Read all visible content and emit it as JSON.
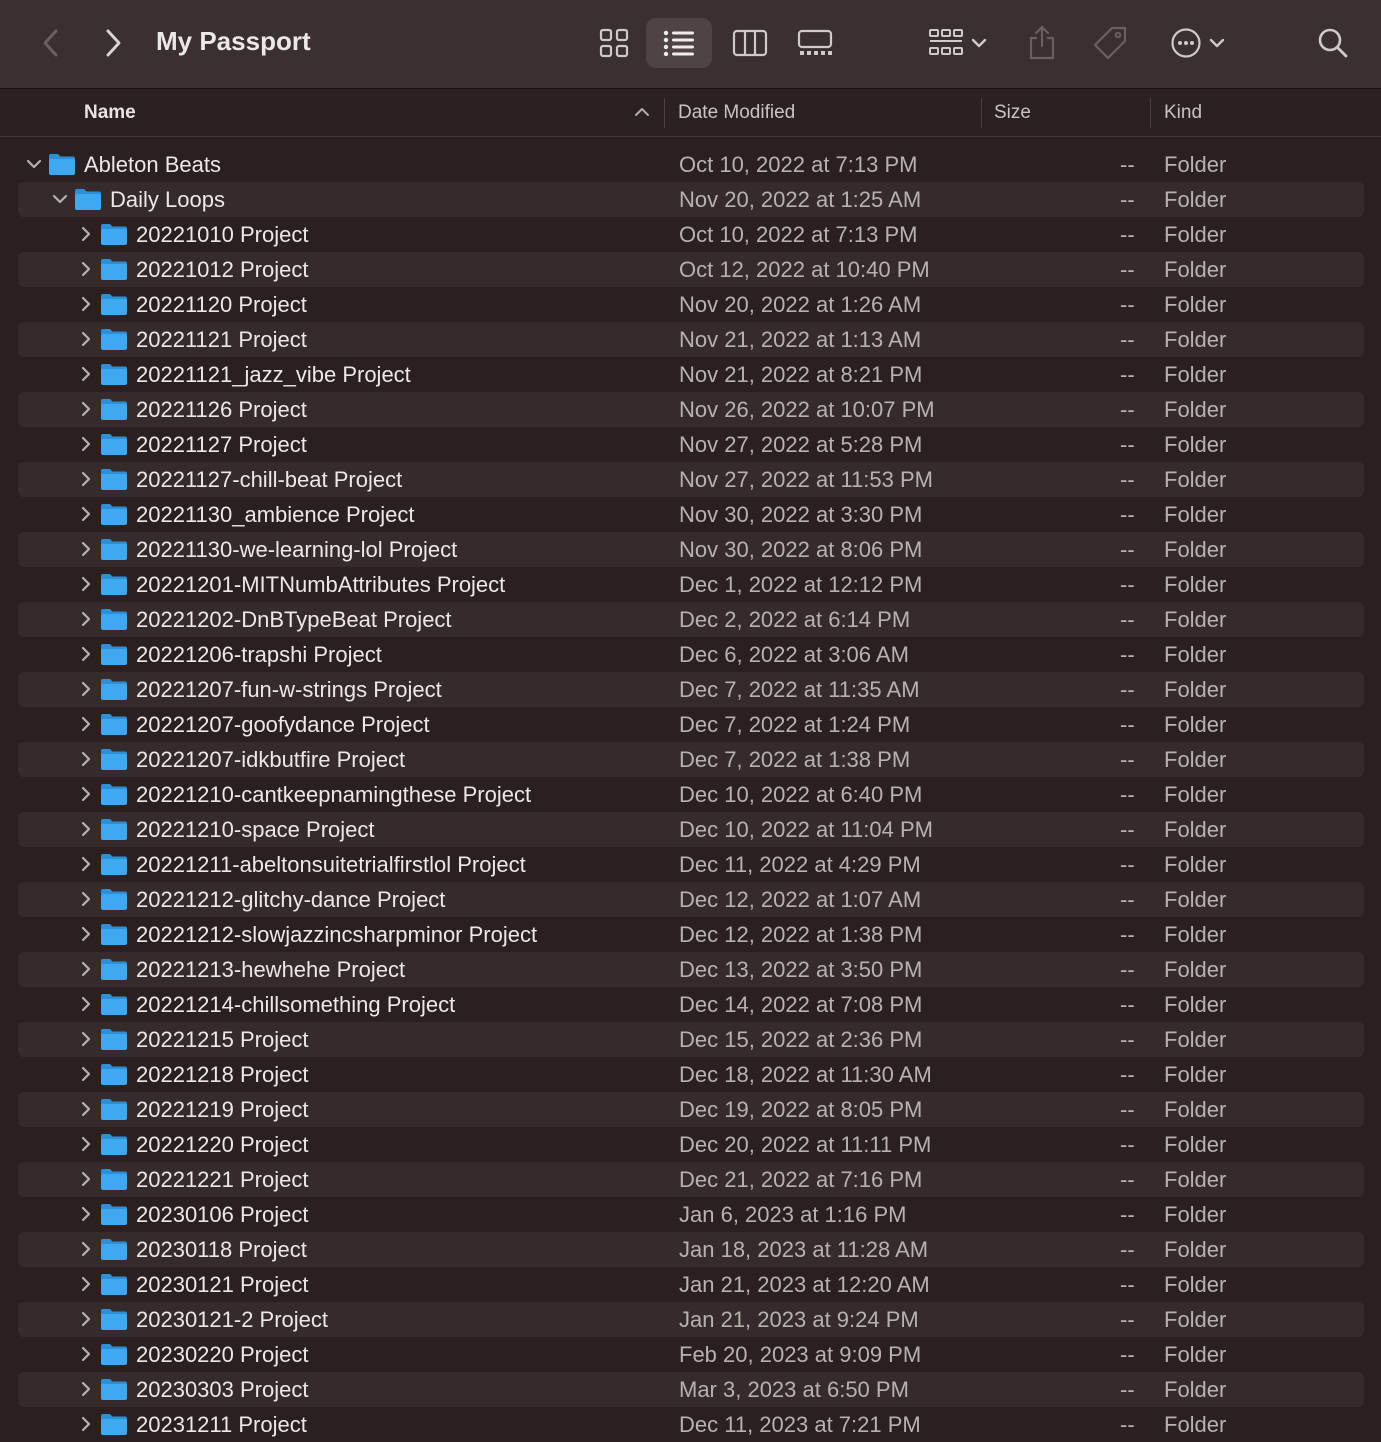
{
  "window": {
    "title": "My Passport"
  },
  "toolbar": {
    "back_icon": "chevron-left-icon",
    "forward_icon": "chevron-right-icon",
    "views": [
      "icon-view",
      "list-view",
      "column-view",
      "gallery-view"
    ],
    "selected_view": "list-view",
    "group_icon": "group-icon",
    "share_icon": "share-icon",
    "tag_icon": "tag-icon",
    "more_icon": "ellipsis-icon",
    "search_icon": "search-icon"
  },
  "columns": {
    "name": "Name",
    "date": "Date Modified",
    "size": "Size",
    "kind": "Kind",
    "sort_icon": "chevron-up-icon"
  },
  "colors": {
    "background": "#2b2020",
    "row_alt": "#362b2b",
    "folder": "#3fa9f0"
  },
  "rows": [
    {
      "name": "Ableton Beats",
      "date": "Oct 10, 2022 at 7:13 PM",
      "size": "--",
      "kind": "Folder",
      "level": 0,
      "expanded": true
    },
    {
      "name": "Daily Loops",
      "date": "Nov 20, 2022 at 1:25 AM",
      "size": "--",
      "kind": "Folder",
      "level": 1,
      "expanded": true
    },
    {
      "name": "20221010 Project",
      "date": "Oct 10, 2022 at 7:13 PM",
      "size": "--",
      "kind": "Folder",
      "level": 2,
      "expanded": false
    },
    {
      "name": "20221012 Project",
      "date": "Oct 12, 2022 at 10:40 PM",
      "size": "--",
      "kind": "Folder",
      "level": 2,
      "expanded": false
    },
    {
      "name": "20221120 Project",
      "date": "Nov 20, 2022 at 1:26 AM",
      "size": "--",
      "kind": "Folder",
      "level": 2,
      "expanded": false
    },
    {
      "name": "20221121 Project",
      "date": "Nov 21, 2022 at 1:13 AM",
      "size": "--",
      "kind": "Folder",
      "level": 2,
      "expanded": false
    },
    {
      "name": "20221121_jazz_vibe Project",
      "date": "Nov 21, 2022 at 8:21 PM",
      "size": "--",
      "kind": "Folder",
      "level": 2,
      "expanded": false
    },
    {
      "name": "20221126 Project",
      "date": "Nov 26, 2022 at 10:07 PM",
      "size": "--",
      "kind": "Folder",
      "level": 2,
      "expanded": false
    },
    {
      "name": "20221127 Project",
      "date": "Nov 27, 2022 at 5:28 PM",
      "size": "--",
      "kind": "Folder",
      "level": 2,
      "expanded": false
    },
    {
      "name": "20221127-chill-beat Project",
      "date": "Nov 27, 2022 at 11:53 PM",
      "size": "--",
      "kind": "Folder",
      "level": 2,
      "expanded": false
    },
    {
      "name": "20221130_ambience Project",
      "date": "Nov 30, 2022 at 3:30 PM",
      "size": "--",
      "kind": "Folder",
      "level": 2,
      "expanded": false
    },
    {
      "name": "20221130-we-learning-lol Project",
      "date": "Nov 30, 2022 at 8:06 PM",
      "size": "--",
      "kind": "Folder",
      "level": 2,
      "expanded": false
    },
    {
      "name": "20221201-MITNumbAttributes Project",
      "date": "Dec 1, 2022 at 12:12 PM",
      "size": "--",
      "kind": "Folder",
      "level": 2,
      "expanded": false
    },
    {
      "name": "20221202-DnBTypeBeat Project",
      "date": "Dec 2, 2022 at 6:14 PM",
      "size": "--",
      "kind": "Folder",
      "level": 2,
      "expanded": false
    },
    {
      "name": "20221206-trapshi Project",
      "date": "Dec 6, 2022 at 3:06 AM",
      "size": "--",
      "kind": "Folder",
      "level": 2,
      "expanded": false
    },
    {
      "name": "20221207-fun-w-strings Project",
      "date": "Dec 7, 2022 at 11:35 AM",
      "size": "--",
      "kind": "Folder",
      "level": 2,
      "expanded": false
    },
    {
      "name": "20221207-goofydance Project",
      "date": "Dec 7, 2022 at 1:24 PM",
      "size": "--",
      "kind": "Folder",
      "level": 2,
      "expanded": false
    },
    {
      "name": "20221207-idkbutfire Project",
      "date": "Dec 7, 2022 at 1:38 PM",
      "size": "--",
      "kind": "Folder",
      "level": 2,
      "expanded": false
    },
    {
      "name": "20221210-cantkeepnamingthese Project",
      "date": "Dec 10, 2022 at 6:40 PM",
      "size": "--",
      "kind": "Folder",
      "level": 2,
      "expanded": false
    },
    {
      "name": "20221210-space Project",
      "date": "Dec 10, 2022 at 11:04 PM",
      "size": "--",
      "kind": "Folder",
      "level": 2,
      "expanded": false
    },
    {
      "name": "20221211-abeltonsuitetrialfirstlol Project",
      "date": "Dec 11, 2022 at 4:29 PM",
      "size": "--",
      "kind": "Folder",
      "level": 2,
      "expanded": false
    },
    {
      "name": "20221212-glitchy-dance Project",
      "date": "Dec 12, 2022 at 1:07 AM",
      "size": "--",
      "kind": "Folder",
      "level": 2,
      "expanded": false
    },
    {
      "name": "20221212-slowjazzincsharpminor Project",
      "date": "Dec 12, 2022 at 1:38 PM",
      "size": "--",
      "kind": "Folder",
      "level": 2,
      "expanded": false
    },
    {
      "name": "20221213-hewhehe Project",
      "date": "Dec 13, 2022 at 3:50 PM",
      "size": "--",
      "kind": "Folder",
      "level": 2,
      "expanded": false
    },
    {
      "name": "20221214-chillsomething Project",
      "date": "Dec 14, 2022 at 7:08 PM",
      "size": "--",
      "kind": "Folder",
      "level": 2,
      "expanded": false
    },
    {
      "name": "20221215 Project",
      "date": "Dec 15, 2022 at 2:36 PM",
      "size": "--",
      "kind": "Folder",
      "level": 2,
      "expanded": false
    },
    {
      "name": "20221218 Project",
      "date": "Dec 18, 2022 at 11:30 AM",
      "size": "--",
      "kind": "Folder",
      "level": 2,
      "expanded": false
    },
    {
      "name": "20221219 Project",
      "date": "Dec 19, 2022 at 8:05 PM",
      "size": "--",
      "kind": "Folder",
      "level": 2,
      "expanded": false
    },
    {
      "name": "20221220 Project",
      "date": "Dec 20, 2022 at 11:11 PM",
      "size": "--",
      "kind": "Folder",
      "level": 2,
      "expanded": false
    },
    {
      "name": "20221221 Project",
      "date": "Dec 21, 2022 at 7:16 PM",
      "size": "--",
      "kind": "Folder",
      "level": 2,
      "expanded": false
    },
    {
      "name": "20230106 Project",
      "date": "Jan 6, 2023 at 1:16 PM",
      "size": "--",
      "kind": "Folder",
      "level": 2,
      "expanded": false
    },
    {
      "name": "20230118 Project",
      "date": "Jan 18, 2023 at 11:28 AM",
      "size": "--",
      "kind": "Folder",
      "level": 2,
      "expanded": false
    },
    {
      "name": "20230121 Project",
      "date": "Jan 21, 2023 at 12:20 AM",
      "size": "--",
      "kind": "Folder",
      "level": 2,
      "expanded": false
    },
    {
      "name": "20230121-2 Project",
      "date": "Jan 21, 2023 at 9:24 PM",
      "size": "--",
      "kind": "Folder",
      "level": 2,
      "expanded": false
    },
    {
      "name": "20230220 Project",
      "date": "Feb 20, 2023 at 9:09 PM",
      "size": "--",
      "kind": "Folder",
      "level": 2,
      "expanded": false
    },
    {
      "name": "20230303 Project",
      "date": "Mar 3, 2023 at 6:50 PM",
      "size": "--",
      "kind": "Folder",
      "level": 2,
      "expanded": false
    },
    {
      "name": "20231211 Project",
      "date": "Dec 11, 2023 at 7:21 PM",
      "size": "--",
      "kind": "Folder",
      "level": 2,
      "expanded": false
    }
  ]
}
